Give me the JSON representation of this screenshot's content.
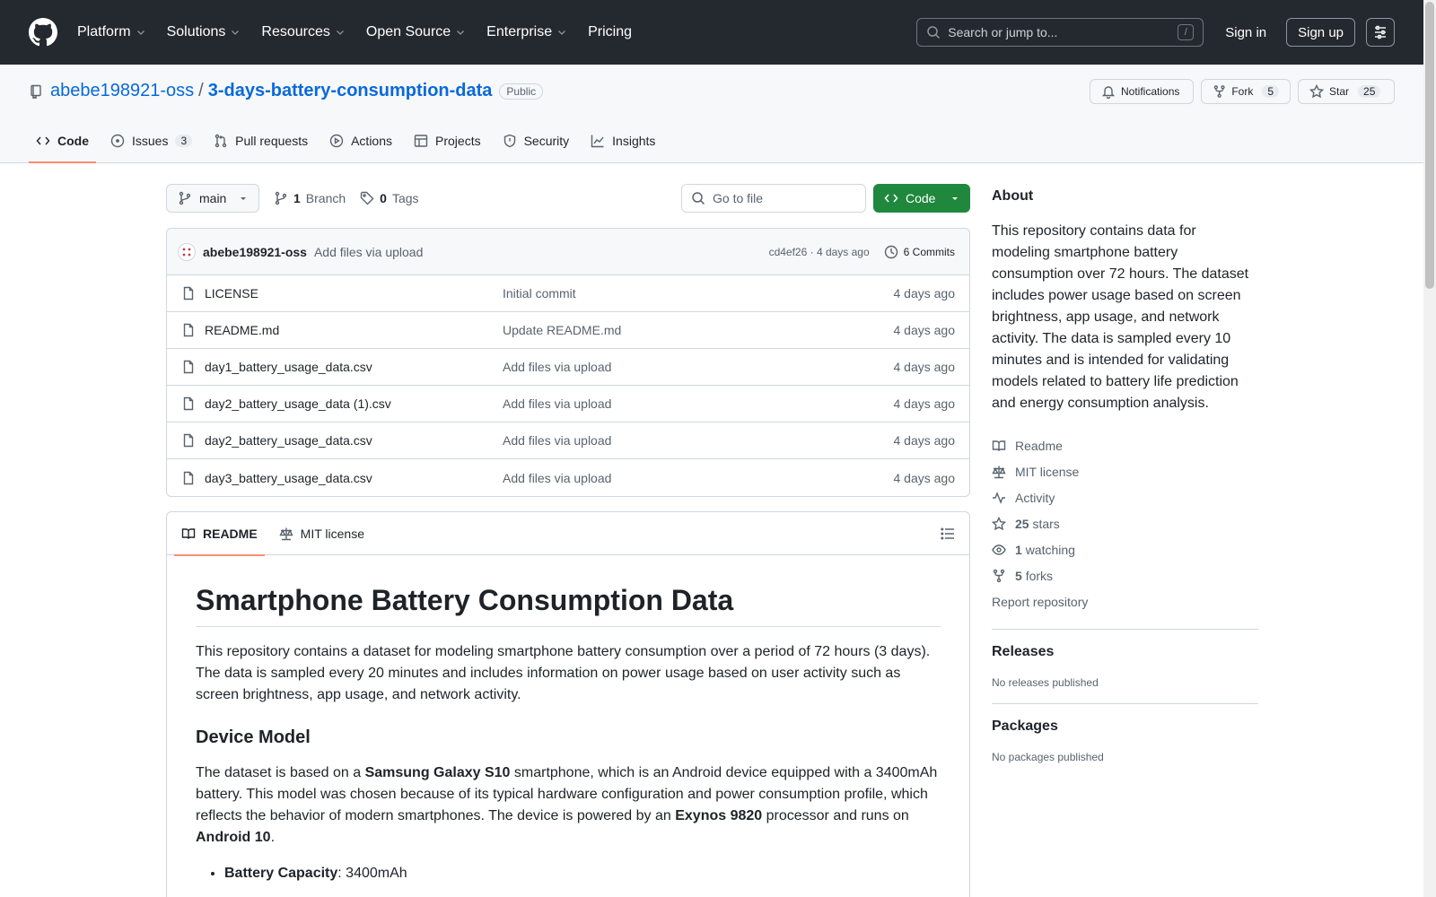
{
  "header": {
    "nav": [
      {
        "label": "Platform",
        "dropdown": true
      },
      {
        "label": "Solutions",
        "dropdown": true
      },
      {
        "label": "Resources",
        "dropdown": true
      },
      {
        "label": "Open Source",
        "dropdown": true
      },
      {
        "label": "Enterprise",
        "dropdown": true
      },
      {
        "label": "Pricing",
        "dropdown": false
      }
    ],
    "search_placeholder": "Search or jump to...",
    "search_shortcut": "/",
    "sign_in": "Sign in",
    "sign_up": "Sign up"
  },
  "repo": {
    "owner": "abebe198921-oss",
    "separator": "/",
    "name": "3-days-battery-consumption-data",
    "visibility": "Public",
    "actions": {
      "notifications": "Notifications",
      "fork_label": "Fork",
      "fork_count": "5",
      "star_label": "Star",
      "star_count": "25"
    },
    "tabs": [
      {
        "label": "Code",
        "icon": "code-icon",
        "count": null,
        "active": true
      },
      {
        "label": "Issues",
        "icon": "issue-icon",
        "count": "3",
        "active": false
      },
      {
        "label": "Pull requests",
        "icon": "pull-request-icon",
        "count": null,
        "active": false
      },
      {
        "label": "Actions",
        "icon": "play-icon",
        "count": null,
        "active": false
      },
      {
        "label": "Projects",
        "icon": "table-icon",
        "count": null,
        "active": false
      },
      {
        "label": "Security",
        "icon": "shield-icon",
        "count": null,
        "active": false
      },
      {
        "label": "Insights",
        "icon": "graph-icon",
        "count": null,
        "active": false
      }
    ]
  },
  "filebar": {
    "branch": "main",
    "branch_count": "1",
    "branch_label": "Branch",
    "tag_count": "0",
    "tag_label": "Tags",
    "goto_placeholder": "Go to file",
    "code_button": "Code"
  },
  "commit": {
    "user": "abebe198921-oss",
    "message": "Add files via upload",
    "hash_time": "cd4ef26 · 4 days ago",
    "commits": "6 Commits"
  },
  "files": [
    {
      "name": "LICENSE",
      "commit": "Initial commit",
      "age": "4 days ago"
    },
    {
      "name": "README.md",
      "commit": "Update README.md",
      "age": "4 days ago"
    },
    {
      "name": "day1_battery_usage_data.csv",
      "commit": "Add files via upload",
      "age": "4 days ago"
    },
    {
      "name": "day2_battery_usage_data (1).csv",
      "commit": "Add files via upload",
      "age": "4 days ago"
    },
    {
      "name": "day2_battery_usage_data.csv",
      "commit": "Add files via upload",
      "age": "4 days ago"
    },
    {
      "name": "day3_battery_usage_data.csv",
      "commit": "Add files via upload",
      "age": "4 days ago"
    }
  ],
  "readme": {
    "tab_readme": "README",
    "tab_license": "MIT license",
    "title": "Smartphone Battery Consumption Data",
    "intro": "This repository contains a dataset for modeling smartphone battery consumption over a period of 72 hours (3 days). The data is sampled every 20 minutes and includes information on power usage based on user activity such as screen brightness, app usage, and network activity.",
    "h2_device": "Device Model",
    "device_p1": "The dataset is based on a ",
    "device_b1": "Samsung Galaxy S10",
    "device_p2": " smartphone, which is an Android device equipped with a 3400mAh battery. This model was chosen because of its typical hardware configuration and power consumption profile, which reflects the behavior of modern smartphones. The device is powered by an ",
    "device_b2": "Exynos 9820",
    "device_p3": " processor and runs on ",
    "device_b3": "Android 10",
    "device_p4": ".",
    "bullet_label": "Battery Capacity",
    "bullet_value": ": 3400mAh"
  },
  "about": {
    "heading": "About",
    "description": "This repository contains data for modeling smartphone battery consumption over 72 hours. The dataset includes power usage based on screen brightness, app usage, and network activity. The data is sampled every 10 minutes and is intended for validating models related to battery life prediction and energy consumption analysis.",
    "readme": "Readme",
    "license": "MIT license",
    "activity": "Activity",
    "stars_count": "25",
    "stars_label": "stars",
    "watching_count": "1",
    "watching_label": "watching",
    "forks_count": "5",
    "forks_label": "forks",
    "report": "Report repository"
  },
  "releases": {
    "heading": "Releases",
    "text": "No releases published"
  },
  "packages": {
    "heading": "Packages",
    "text": "No packages published"
  },
  "colors": {
    "header_bg": "#24292f",
    "link": "#0969da",
    "green": "#1f883d",
    "tab_underline": "#fd8c73"
  }
}
